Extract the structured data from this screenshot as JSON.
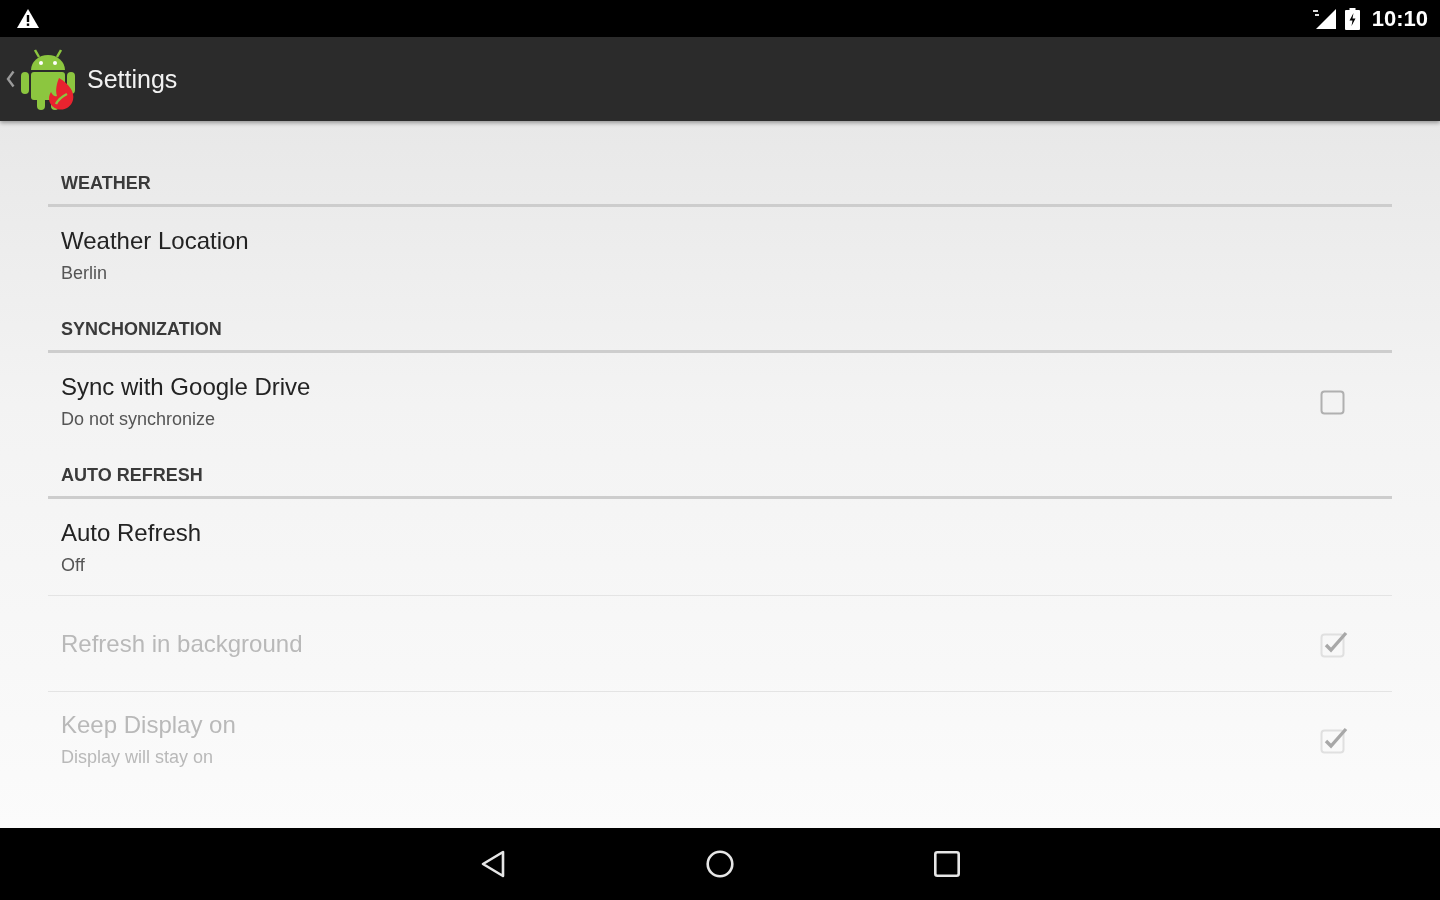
{
  "status_bar": {
    "time": "10:10"
  },
  "action_bar": {
    "title": "Settings"
  },
  "categories": [
    {
      "title": "WEATHER",
      "items": [
        {
          "kind": "text",
          "title": "Weather Location",
          "summary": "Berlin",
          "disabled": false
        }
      ]
    },
    {
      "title": "SYNCHONIZATION",
      "items": [
        {
          "kind": "checkbox",
          "title": "Sync with Google Drive",
          "summary": "Do not synchronize",
          "checked": false,
          "disabled": false
        }
      ]
    },
    {
      "title": "AUTO REFRESH",
      "items": [
        {
          "kind": "text",
          "title": "Auto Refresh",
          "summary": "Off",
          "disabled": false
        },
        {
          "kind": "checkbox",
          "title": "Refresh in background",
          "checked": true,
          "disabled": true
        },
        {
          "kind": "checkbox",
          "title": "Keep Display on",
          "summary": "Display will stay on",
          "checked": true,
          "disabled": true
        }
      ]
    }
  ]
}
